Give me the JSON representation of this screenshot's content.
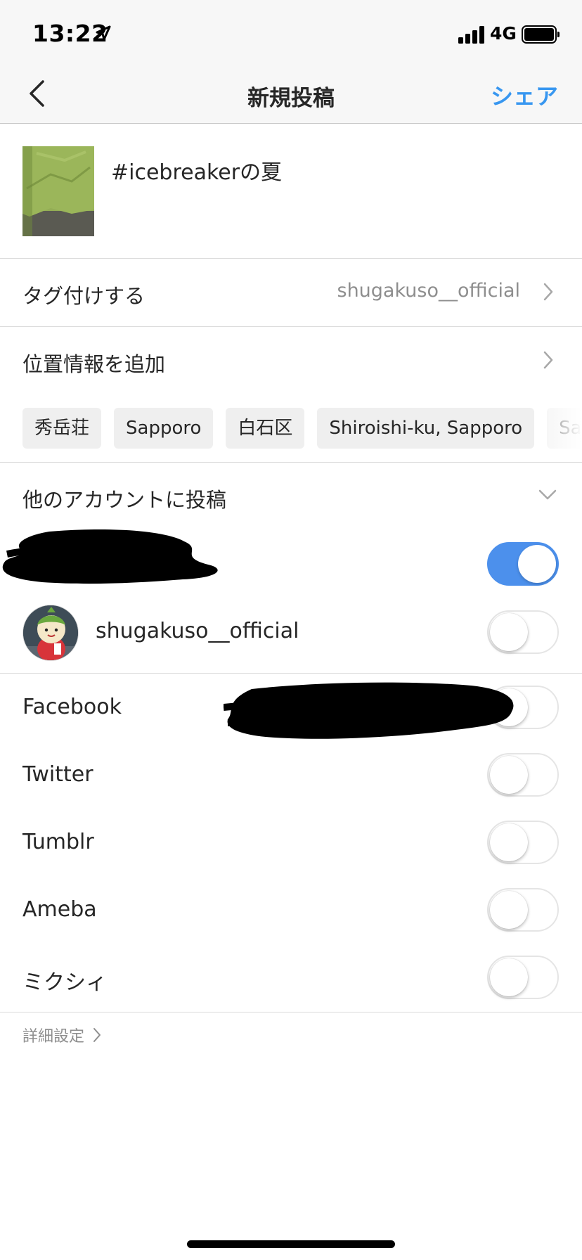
{
  "status_bar": {
    "time": "13:22",
    "network": "4G"
  },
  "nav": {
    "title": "新規投稿",
    "share": "シェア"
  },
  "post": {
    "caption": "#icebreakerの夏"
  },
  "tag_people": {
    "label": "タグ付けする",
    "value": "shugakuso__official"
  },
  "location": {
    "label": "位置情報を追加",
    "suggestions": [
      "秀岳荘",
      "Sapporo",
      "白石区",
      "Shiroishi-ku, Sapporo",
      "Sa"
    ]
  },
  "other_accounts": {
    "label": "他のアカウントに投稿",
    "accounts": [
      {
        "name": "",
        "enabled": true
      },
      {
        "name": "shugakuso__official",
        "enabled": false
      }
    ]
  },
  "social": [
    {
      "label": "Facebook",
      "enabled": false
    },
    {
      "label": "Twitter",
      "enabled": false
    },
    {
      "label": "Tumblr",
      "enabled": false
    },
    {
      "label": "Ameba",
      "enabled": false
    },
    {
      "label": "ミクシィ",
      "enabled": false
    }
  ],
  "advanced_settings": "詳細設定",
  "colors": {
    "accent": "#3897f0",
    "toggle_on": "#4c90ec"
  }
}
